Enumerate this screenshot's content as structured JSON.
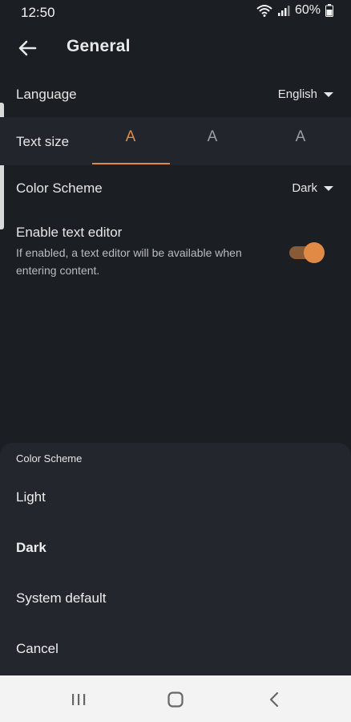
{
  "status_bar": {
    "time": "12:50",
    "battery": "60%"
  },
  "app_bar": {
    "title": "General"
  },
  "settings": {
    "language": {
      "label": "Language",
      "value": "English"
    },
    "text_size": {
      "label": "Text size",
      "options": [
        "A",
        "A",
        "A"
      ],
      "selected_index": 0
    },
    "color_scheme": {
      "label": "Color Scheme",
      "value": "Dark"
    },
    "text_editor": {
      "label": "Enable text editor",
      "description": "If enabled, a text editor will be available when entering content.",
      "enabled": true
    }
  },
  "sheet": {
    "title": "Color Scheme",
    "items": [
      {
        "label": "Light"
      },
      {
        "label": "Dark"
      },
      {
        "label": "System default"
      },
      {
        "label": "Cancel"
      }
    ]
  },
  "colors": {
    "accent": "#e08a45",
    "background": "#1b1e23",
    "sheet": "#23262d",
    "nav_bar": "#f3f3f3"
  },
  "icons": {
    "back": "arrow-left-icon",
    "wifi": "wifi-icon",
    "signal": "signal-icon",
    "battery": "battery-icon",
    "nav_recent": "recent-apps-icon",
    "nav_home": "home-icon",
    "nav_back": "chevron-left-icon"
  }
}
